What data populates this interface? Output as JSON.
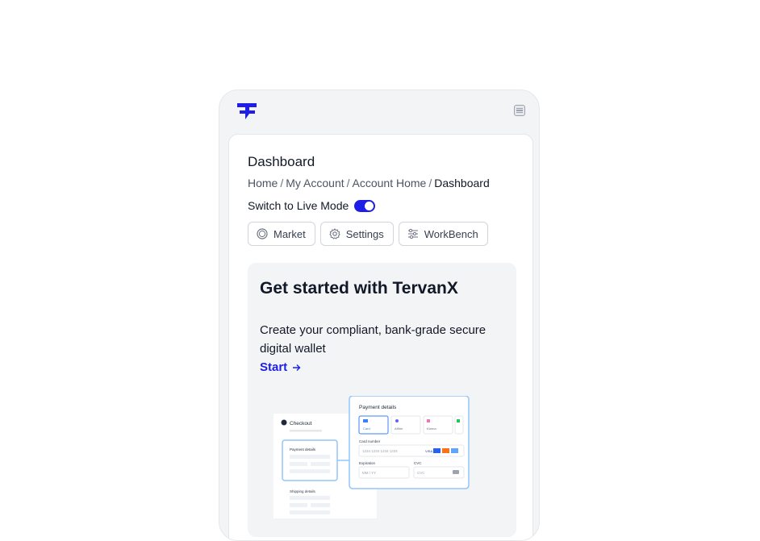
{
  "header": {
    "logo": "tervanx-logo",
    "menu_icon": "menu-icon"
  },
  "page": {
    "title": "Dashboard",
    "breadcrumb": [
      {
        "label": "Home"
      },
      {
        "label": "My Account"
      },
      {
        "label": "Account Home"
      },
      {
        "label": "Dashboard"
      }
    ],
    "breadcrumb_separator": "/"
  },
  "live_mode": {
    "label": "Switch to Live Mode",
    "enabled": true
  },
  "tabs": [
    {
      "label": "Market",
      "icon": "market-icon"
    },
    {
      "label": "Settings",
      "icon": "gear-icon"
    },
    {
      "label": "WorkBench",
      "icon": "workbench-icon"
    }
  ],
  "promo": {
    "title": "Get started with TervanX",
    "description": "Create your compliant, bank-grade secure digital wallet",
    "cta_label": "Start",
    "cta_icon": "arrow-right-icon"
  },
  "illustration": {
    "checkout_label": "Checkout",
    "payment_details_small": "Payment details",
    "shipping_details": "Shipping details",
    "payment_details_title": "Payment details",
    "methods": [
      "Card",
      "Affirm",
      "Klarna"
    ],
    "card_number_label": "Card number",
    "card_number_placeholder": "1234 1234 1234 1234",
    "card_brand": "VISA",
    "expiration_label": "Expiration",
    "expiration_placeholder": "MM / YY",
    "cvc_label": "CVC",
    "cvc_placeholder": "CVC"
  },
  "colors": {
    "accent": "#1e1ee6",
    "background": "#f3f4f6",
    "card": "#ffffff"
  }
}
